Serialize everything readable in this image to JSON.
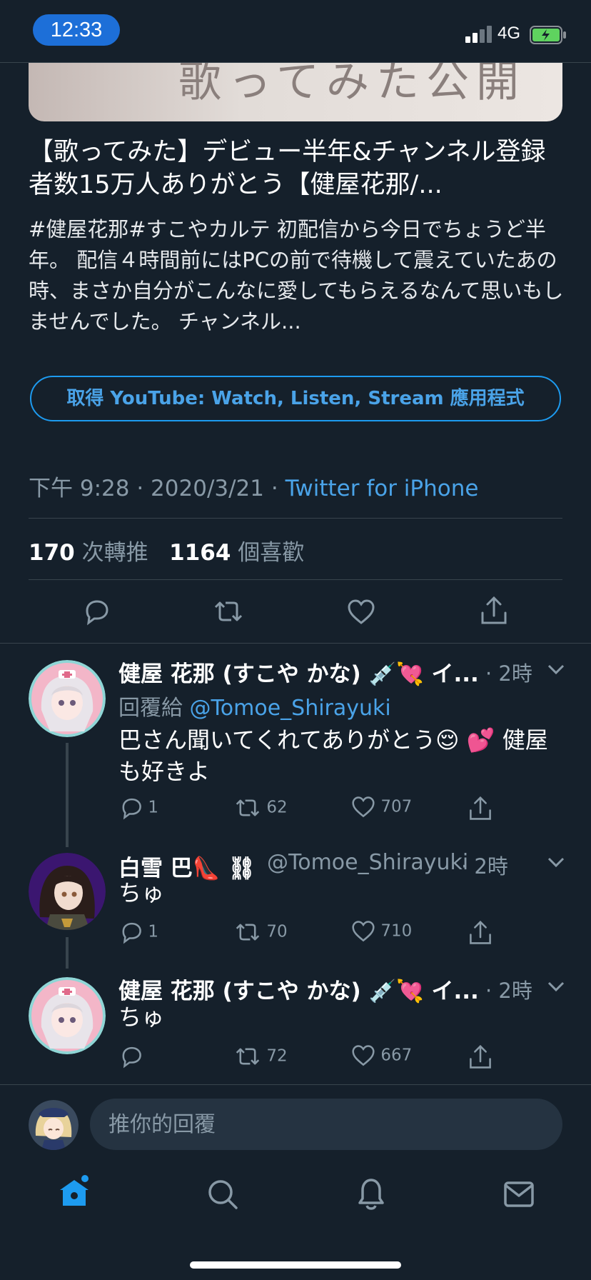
{
  "status_bar": {
    "time": "12:33",
    "network": "4G",
    "battery_color": "#5fd35f"
  },
  "card": {
    "image_overlay_text": "歌ってみた公開",
    "title": "【歌ってみた】デビュー半年&チャンネル登録者数15万人ありがとう【健屋花那/...",
    "description": "#健屋花那#すこやカルテ 初配信から今日でちょうど半年。 配信４時間前にはPCの前で待機して震えていたあの時、まさか自分がこんなに愛してもらえるなんて思いもしませんでした。 チャンネル..."
  },
  "get_app_button": "取得 YouTube: Watch, Listen, Stream 應用程式",
  "tweet_meta": {
    "time": "下午 9:28",
    "date": "2020/3/21",
    "separator": "·",
    "source": "Twitter for iPhone"
  },
  "stats": {
    "retweets_count": "170",
    "retweets_label": "次轉推",
    "likes_count": "1164",
    "likes_label": "個喜歡"
  },
  "main_actions": [
    "reply-icon",
    "retweet-icon",
    "like-icon",
    "share-icon"
  ],
  "replies": [
    {
      "name": "健屋 花那 (すこや かな) 💉💘 イ...",
      "time": "· 2時",
      "reply_to_label": "回覆給",
      "reply_to_handle": "@Tomoe_Shirayuki",
      "text": "巴さん聞いてくれてありがとう😌 💕 健屋も好きよ",
      "replies": "1",
      "retweets": "62",
      "likes": "707"
    },
    {
      "name": "白雪 巴👠 ⛓",
      "handle": "@Tomoe_Shirayuki",
      "time": "· 2時",
      "text": "ちゅ",
      "replies": "1",
      "retweets": "70",
      "likes": "710"
    },
    {
      "name": "健屋 花那 (すこや かな) 💉💘 イ...",
      "time": "· 2時",
      "text": "ちゅ",
      "replies": "",
      "retweets": "72",
      "likes": "667"
    }
  ],
  "reply_bar": {
    "placeholder": "推你的回覆"
  },
  "tab_bar": [
    "home-icon",
    "search-icon",
    "notifications-icon",
    "messages-icon"
  ],
  "colors": {
    "background": "#15202b",
    "accent": "#1d9bf0",
    "secondary_text": "#8899a6",
    "divider": "#38444d"
  }
}
